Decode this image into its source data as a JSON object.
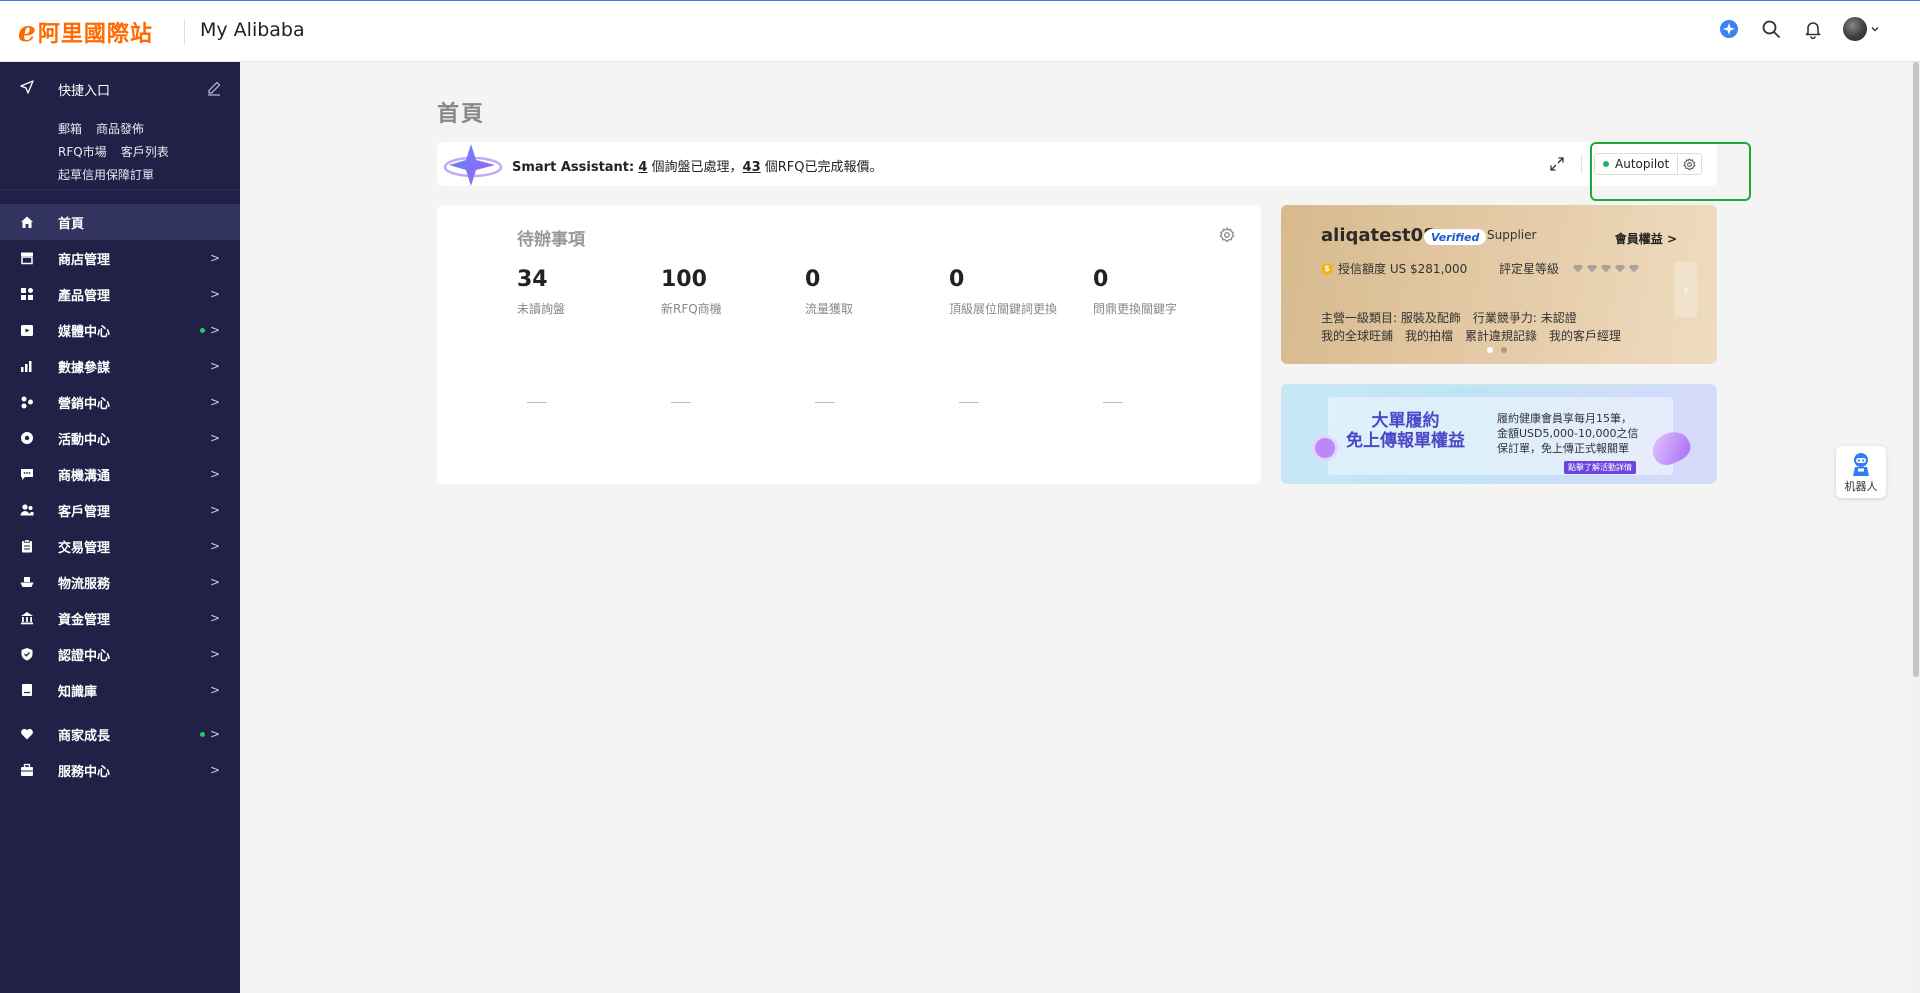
{
  "header": {
    "logo_mark": "e",
    "logo_text": "阿里國際站",
    "app_title": "My Alibaba",
    "icons": [
      "ai-assistant-icon",
      "search-icon",
      "bell-icon",
      "avatar",
      "chevron-down-icon"
    ]
  },
  "sidebar": {
    "quick_entry": {
      "label": "快捷入口",
      "links_row1": [
        "郵箱",
        "商品發佈"
      ],
      "links_row2": [
        "RFQ市場",
        "客戶列表"
      ],
      "links_row3": [
        "起草信用保障訂單"
      ]
    },
    "items": [
      {
        "label": "首頁",
        "icon": "home-icon",
        "active": true
      },
      {
        "label": "商店管理",
        "icon": "store-icon"
      },
      {
        "label": "產品管理",
        "icon": "grid-icon"
      },
      {
        "label": "媒體中心",
        "icon": "media-icon",
        "dot": true
      },
      {
        "label": "數據參謀",
        "icon": "chart-icon"
      },
      {
        "label": "營銷中心",
        "icon": "marketing-icon"
      },
      {
        "label": "活動中心",
        "icon": "activity-icon"
      },
      {
        "label": "商機溝通",
        "icon": "chat-icon"
      },
      {
        "label": "客戶管理",
        "icon": "customers-icon"
      },
      {
        "label": "交易管理",
        "icon": "clipboard-icon"
      },
      {
        "label": "物流服務",
        "icon": "ship-icon"
      },
      {
        "label": "資金管理",
        "icon": "bank-icon"
      },
      {
        "label": "認證中心",
        "icon": "shield-icon"
      },
      {
        "label": "知識庫",
        "icon": "book-icon"
      },
      {
        "label": "商家成長",
        "icon": "heart-icon",
        "dot": true
      },
      {
        "label": "服務中心",
        "icon": "briefcase-icon"
      }
    ],
    "arrow": ">"
  },
  "page": {
    "title": "首頁"
  },
  "assistant": {
    "label": "Smart Assistant:",
    "count1": "4",
    "text1": " 個詢盤已處理，",
    "count2": "43",
    "text2": " 個RFQ已完成報價。",
    "autopilot_label": "Autopilot"
  },
  "todo": {
    "title": "待辦事項",
    "stats": [
      {
        "value": "34",
        "label": "未讀詢盤"
      },
      {
        "value": "100",
        "label": "新RFQ商機"
      },
      {
        "value": "0",
        "label": "流量獲取"
      },
      {
        "value": "0",
        "label": "頂級展位關鍵詞更換"
      },
      {
        "value": "0",
        "label": "問鼎更換關鍵字"
      }
    ]
  },
  "profile": {
    "username": "aliqatest08",
    "verified": "Verified",
    "supplier": "Supplier",
    "member_rights": "會員權益 >",
    "credit": "授信額度 US $281,000",
    "rating_label": "評定星等級",
    "rating_diamonds": 5,
    "category": "主營一級類目: 服裝及配飾",
    "competitiveness": "行業競爭力: 未認證",
    "links": [
      "我的全球旺鋪",
      "我的拍檔",
      "累計違規記錄",
      "我的客戶經理"
    ],
    "carousel_pages": 2,
    "carousel_active": 1
  },
  "banner": {
    "headline1": "大單履約",
    "headline2": "免上傳報單權益",
    "desc1": "履約健康會員享每月15筆，",
    "desc2": "金額USD5,000-10,000之信",
    "desc3": "保訂單，免上傳正式報關單",
    "tag": "點擊了解活動詳情"
  },
  "robot": {
    "label": "机器人"
  },
  "colors": {
    "sidebar_bg": "#212148",
    "brand_orange": "#ff6a00",
    "highlight_green": "#1fa83a",
    "status_green": "#2ec56c"
  }
}
